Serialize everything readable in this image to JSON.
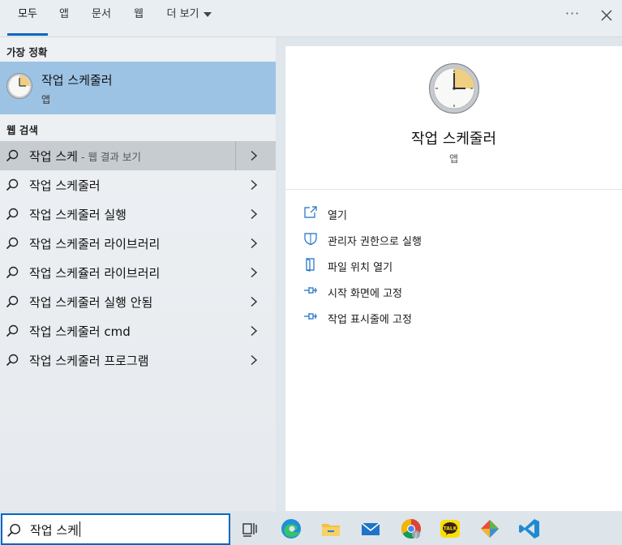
{
  "tabs": [
    {
      "label": "모두",
      "active": true
    },
    {
      "label": "앱"
    },
    {
      "label": "문서"
    },
    {
      "label": "웹"
    },
    {
      "label": "더 보기"
    }
  ],
  "top_controls": {
    "more_icon": "ellipsis-icon",
    "close_icon": "close-icon"
  },
  "best_match": {
    "header": "가장 정확",
    "title": "작업 스케줄러",
    "subtitle": "앱",
    "icon": "clock-icon"
  },
  "web_search": {
    "header": "웹 검색",
    "items": [
      {
        "label": "작업 스케",
        "suffix": "- 웹 결과 보기"
      },
      {
        "label": "작업 스케줄러"
      },
      {
        "label": "작업 스케줄러 실행"
      },
      {
        "label": "작업 스케줄러 라이브러리"
      },
      {
        "label": "작업 스케쥴러 라이브러리"
      },
      {
        "label": "작업 스케줄러 실행 안됨"
      },
      {
        "label": "작업 스케줄러 cmd"
      },
      {
        "label": "작업 스케줄러 프로그램"
      }
    ]
  },
  "detail": {
    "title": "작업 스케줄러",
    "subtitle": "앱",
    "actions": [
      {
        "label": "열기",
        "icon": "open-icon"
      },
      {
        "label": "관리자 권한으로 실행",
        "icon": "shield-icon"
      },
      {
        "label": "파일 위치 열기",
        "icon": "file-location-icon"
      },
      {
        "label": "시작 화면에 고정",
        "icon": "pin-icon"
      },
      {
        "label": "작업 표시줄에 고정",
        "icon": "pin-icon"
      }
    ]
  },
  "search_box": {
    "query": "작업 스케"
  },
  "taskbar_icons": [
    "task-view-icon",
    "edge-icon",
    "file-explorer-icon",
    "mail-icon",
    "chrome-icon",
    "kakaotalk-icon",
    "git-icon",
    "vscode-icon"
  ],
  "colors": {
    "accent": "#0a66c2",
    "best_match_bg": "#9dc3e4",
    "highlight_row_bg": "#c7ccd1"
  }
}
